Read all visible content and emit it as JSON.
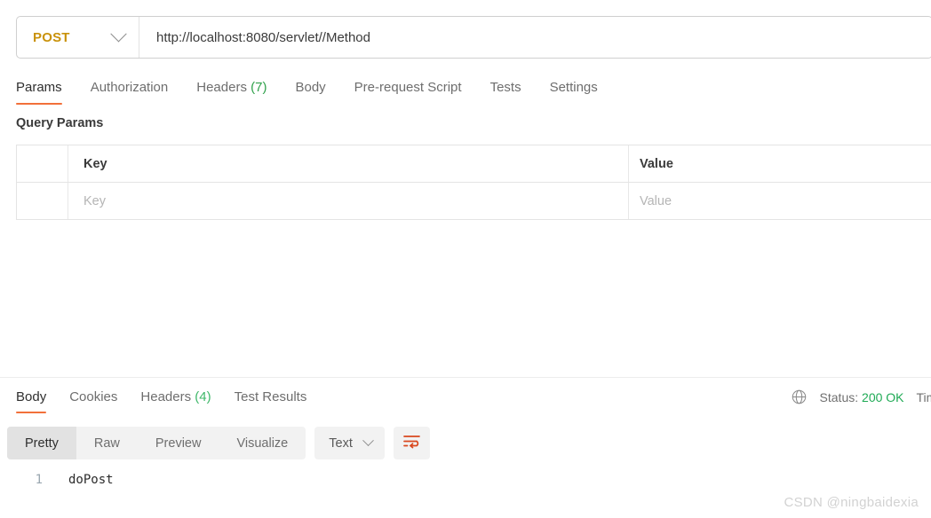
{
  "request_bar": {
    "method": "POST",
    "method_caret_icon": "chevron-down-icon",
    "url": "http://localhost:8080/servlet//Method"
  },
  "request_tabs": [
    {
      "label": "Params",
      "active": true
    },
    {
      "label": "Authorization",
      "active": false
    },
    {
      "label": "Headers",
      "count": "(7)",
      "active": false
    },
    {
      "label": "Body",
      "active": false
    },
    {
      "label": "Pre-request Script",
      "active": false
    },
    {
      "label": "Tests",
      "active": false
    },
    {
      "label": "Settings",
      "active": false
    }
  ],
  "query_params": {
    "section_title": "Query Params",
    "columns": [
      "Key",
      "Value"
    ],
    "rows": [
      {
        "key_placeholder": "Key",
        "value_placeholder": "Value"
      }
    ]
  },
  "response_tabs": [
    {
      "label": "Body",
      "active": true
    },
    {
      "label": "Cookies",
      "active": false
    },
    {
      "label": "Headers",
      "count": "(4)",
      "active": false
    },
    {
      "label": "Test Results",
      "active": false
    }
  ],
  "status": {
    "globe_icon": "globe-icon",
    "status_label": "Status:",
    "status_code": "200 OK",
    "time_label": "Time:"
  },
  "view_modes": [
    {
      "label": "Pretty",
      "active": true
    },
    {
      "label": "Raw",
      "active": false
    },
    {
      "label": "Preview",
      "active": false
    },
    {
      "label": "Visualize",
      "active": false
    }
  ],
  "format_select": {
    "value": "Text",
    "caret_icon": "chevron-down-icon"
  },
  "wrap_button": {
    "icon": "word-wrap-icon"
  },
  "response_body": {
    "lines": [
      {
        "number": "1",
        "text": "doPost"
      }
    ]
  },
  "watermark": "CSDN @ningbaidexia",
  "colors": {
    "accent": "#f2703a",
    "method": "#c9920b",
    "success": "#1faa55",
    "count": "#31a24c",
    "wrap_icon": "#d9481f"
  }
}
